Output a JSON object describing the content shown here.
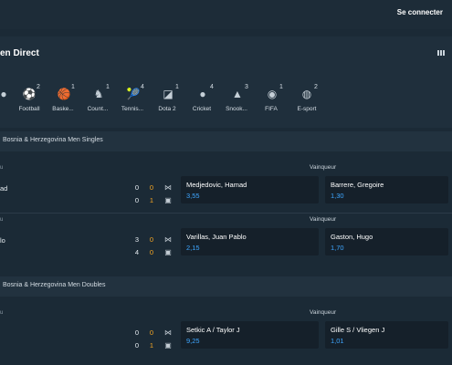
{
  "header": {
    "login_label": "Se connecter"
  },
  "live": {
    "title": "en Direct",
    "sports": [
      {
        "icon": "partial-sport-icon",
        "count": "",
        "label": ""
      },
      {
        "icon": "football-icon",
        "count": "2",
        "label": "Football"
      },
      {
        "icon": "basketball-icon",
        "count": "1",
        "label": "Baske..."
      },
      {
        "icon": "counter-strike-icon",
        "count": "1",
        "label": "Count..."
      },
      {
        "icon": "tennis-icon",
        "count": "4",
        "label": "Tennis..."
      },
      {
        "icon": "dota2-icon",
        "count": "1",
        "label": "Dota 2"
      },
      {
        "icon": "cricket-icon",
        "count": "4",
        "label": "Cricket"
      },
      {
        "icon": "snooker-icon",
        "count": "3",
        "label": "Snook..."
      },
      {
        "icon": "fifa-icon",
        "count": "1",
        "label": "FIFA"
      },
      {
        "icon": "esport-icon",
        "count": "2",
        "label": "E-sport"
      }
    ]
  },
  "competitions": [
    {
      "name": "Bosnia & Herzegovina Men Singles",
      "matches": [
        {
          "partial_label": "u",
          "partial_name": "ad",
          "winner_label": "Vainqueur",
          "scores": {
            "p1_main": "0",
            "p1_cur": "0",
            "p2_main": "0",
            "p2_cur": "1"
          },
          "odds": [
            {
              "player": "Medjedovic, Hamad",
              "odd": "3,55"
            },
            {
              "player": "Barrere, Gregoire",
              "odd": "1,30"
            }
          ]
        },
        {
          "partial_label": "u",
          "partial_name": "lo",
          "winner_label": "Vainqueur",
          "scores": {
            "p1_main": "3",
            "p1_cur": "0",
            "p2_main": "4",
            "p2_cur": "0"
          },
          "odds": [
            {
              "player": "Varillas, Juan Pablo",
              "odd": "2,15"
            },
            {
              "player": "Gaston, Hugo",
              "odd": "1,70"
            }
          ]
        }
      ]
    },
    {
      "name": "Bosnia & Herzegovina Men Doubles",
      "matches": [
        {
          "partial_label": "u",
          "partial_name": "",
          "winner_label": "Vainqueur",
          "scores": {
            "p1_main": "0",
            "p1_cur": "0",
            "p2_main": "0",
            "p2_cur": "1"
          },
          "odds": [
            {
              "player": "Setkic A / Taylor J",
              "odd": "9,25"
            },
            {
              "player": "Gille S / Vliegen J",
              "odd": "1,01"
            }
          ]
        }
      ]
    }
  ]
}
